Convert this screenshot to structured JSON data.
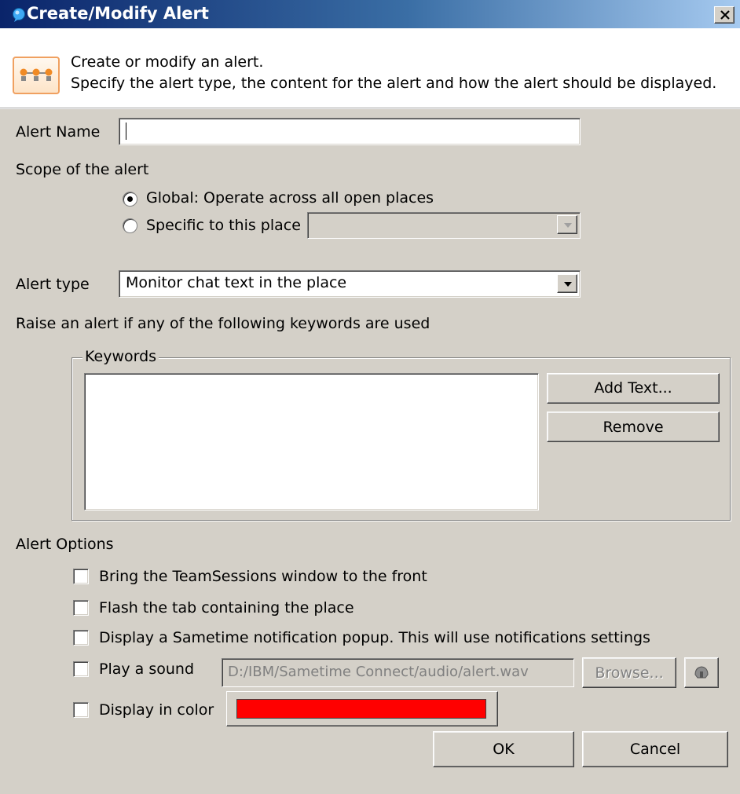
{
  "window": {
    "title": "Create/Modify Alert",
    "close_icon": "close-icon"
  },
  "header": {
    "line1": "Create or modify an alert.",
    "line2": "Specify the alert type, the content for the alert and how the alert should be displayed.",
    "icon": "alert-banner-icon"
  },
  "alert_name": {
    "label": "Alert Name",
    "value": ""
  },
  "scope": {
    "label": "Scope of the alert",
    "options": [
      {
        "label": "Global: Operate across all open places",
        "selected": true
      },
      {
        "label": "Specific to this place",
        "selected": false
      }
    ],
    "place_value": ""
  },
  "alert_type": {
    "label": "Alert type",
    "value": "Monitor chat text in the place"
  },
  "keywords": {
    "instruction": "Raise an alert if any of the following keywords are used",
    "group_label": "Keywords",
    "items": [],
    "add_button": "Add Text...",
    "remove_button": "Remove"
  },
  "options": {
    "label": "Alert Options",
    "bring_front": "Bring the TeamSessions window to the front",
    "flash_tab": "Flash the tab containing the place",
    "notification_popup": "Display a Sametime notification popup. This will use notifications settings",
    "play_sound": "Play a sound",
    "sound_path": "D:/IBM/Sametime Connect/audio/alert.wav",
    "browse_button": "Browse...",
    "display_color": "Display in color",
    "color": "#ff0000"
  },
  "footer": {
    "ok": "OK",
    "cancel": "Cancel"
  }
}
